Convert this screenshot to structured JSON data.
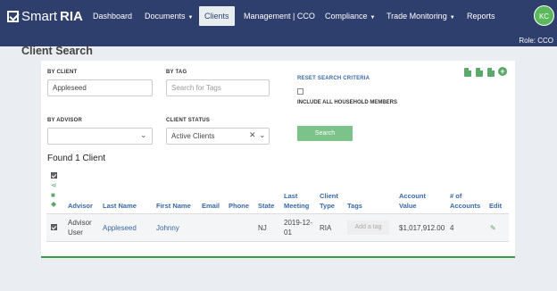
{
  "brand": {
    "name_light": "Smart",
    "name_bold": "RIA"
  },
  "nav": {
    "dashboard": "Dashboard",
    "documents": "Documents",
    "clients": "Clients",
    "management": "Management | CCO",
    "compliance": "Compliance",
    "trade_monitoring": "Trade Monitoring",
    "reports": "Reports",
    "caret": "▼"
  },
  "user": {
    "initials": "KC",
    "role": "Role: CCO"
  },
  "page": {
    "title": "Client Search"
  },
  "search": {
    "by_client_label": "BY CLIENT",
    "by_client_value": "Appleseed",
    "by_tag_label": "BY TAG",
    "by_tag_placeholder": "Search for Tags",
    "reset_label": "RESET SEARCH CRITERIA",
    "household_label": "INCLUDE ALL HOUSEHOLD MEMBERS",
    "by_advisor_label": "BY ADVISOR",
    "by_advisor_value": "",
    "client_status_label": "CLIENT STATUS",
    "client_status_value": "Active Clients",
    "search_button": "Search"
  },
  "results": {
    "found_text": "Found 1 Client",
    "columns": {
      "advisor": "Advisor",
      "last_name": "Last Name",
      "first_name": "First Name",
      "email": "Email",
      "phone": "Phone",
      "state": "State",
      "last_meeting_1": "Last",
      "last_meeting_2": "Meeting",
      "client_type_1": "Client",
      "client_type_2": "Type",
      "tags": "Tags",
      "account_value_1": "Account",
      "account_value_2": "Value",
      "num_accounts_1": "# of",
      "num_accounts_2": "Accounts",
      "edit": "Edit"
    },
    "rows": [
      {
        "advisor_1": "Advisor",
        "advisor_2": "User",
        "last_name": "Appleseed",
        "first_name": "Johnny",
        "email": "",
        "phone": "",
        "state": "NJ",
        "last_meeting_1": "2019-12-",
        "last_meeting_2": "01",
        "client_type": "RIA",
        "tag_button": "Add a tag",
        "account_value": "$1,017,912.00",
        "num_accounts": "4"
      }
    ]
  },
  "colors": {
    "nav_bg": "#2e3f6e",
    "accent_green": "#5aa86a",
    "link_blue": "#3a68a8",
    "avatar": "#5cb85c"
  },
  "icons": [
    "check-logo-icon",
    "file-export-icon",
    "plus-circle-icon",
    "chevron-down-icon",
    "clear-x-icon",
    "share-icon",
    "lock-icon",
    "tag-icon",
    "pencil-edit-icon"
  ]
}
